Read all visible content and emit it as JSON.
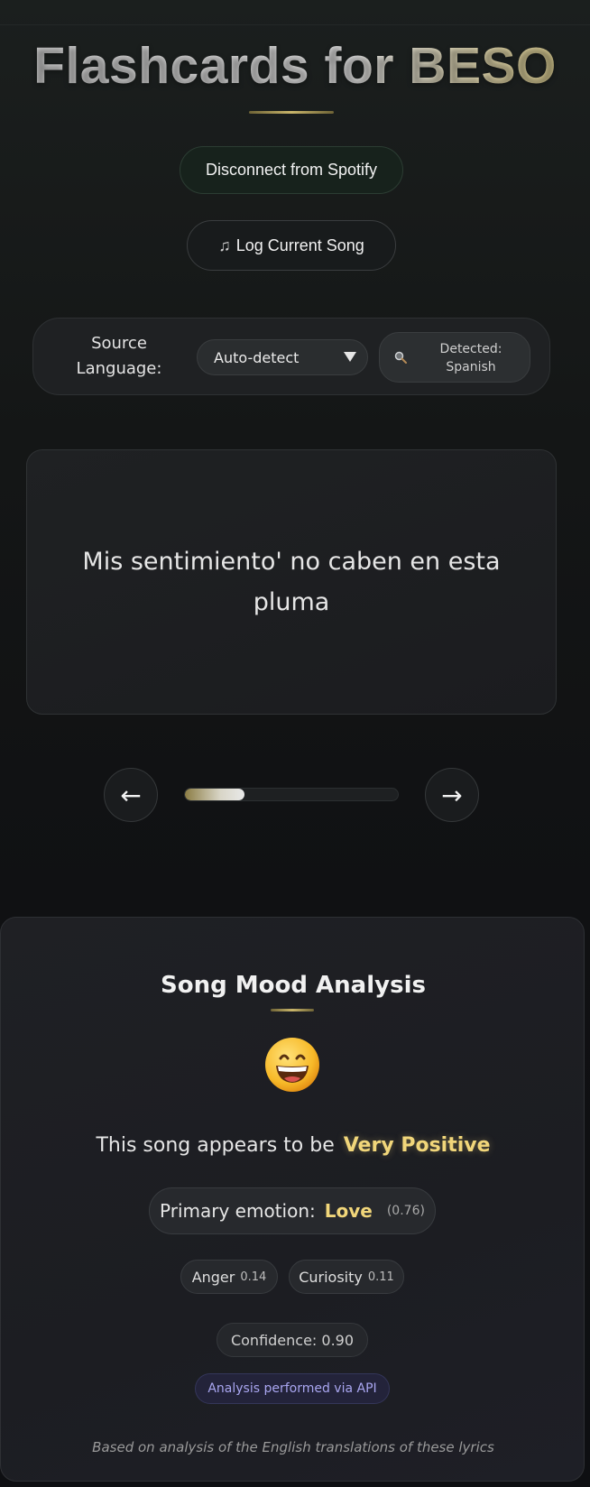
{
  "header": {
    "title": "Flashcards for BESO"
  },
  "spotify": {
    "disconnect_label": "Disconnect from Spotify",
    "log_song_icon": "music-note-icon",
    "log_song_label": "Log Current Song"
  },
  "language": {
    "label": "Source Language:",
    "selected": "Auto-detect",
    "detected_icon": "magnifier-icon",
    "detected_label": "Detected:",
    "detected_value": "Spanish"
  },
  "flashcard": {
    "text": "Mis sentimiento' no caben en esta pluma"
  },
  "navigation": {
    "prev_icon": "←",
    "next_icon": "→",
    "progress": 0.28
  },
  "mood": {
    "title": "Song Mood Analysis",
    "emoji": "grinning-face-icon",
    "sentence_prefix": "This song appears to be",
    "sentiment": "Very Positive",
    "primary_label": "Primary emotion:",
    "primary_value": "Love",
    "primary_score": "(0.76)",
    "emotions": [
      {
        "name": "Anger",
        "score": "0.14"
      },
      {
        "name": "Curiosity",
        "score": "0.11"
      }
    ],
    "confidence": "Confidence: 0.90",
    "api_note": "Analysis performed via API",
    "footnote": "Based on analysis of the English translations of these lyrics"
  },
  "colors": {
    "accent_gold": "#f1d67a",
    "api_purple": "#a9a6f0"
  }
}
